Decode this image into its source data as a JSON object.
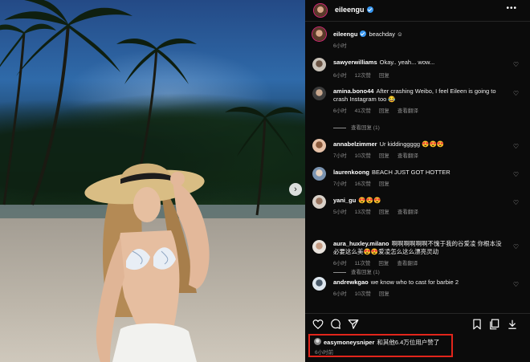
{
  "post": {
    "username": "eileengu",
    "caption": "beachday",
    "caption_emoji": "☺",
    "caption_time": "6小时",
    "menu_icon": "more-icon"
  },
  "comments": [
    {
      "user": "sawyerwilliams",
      "text": "Okay.. yeah... wow...",
      "time": "6小时",
      "likes": "12次赞",
      "reply": "回复",
      "translate": "",
      "view_replies": ""
    },
    {
      "user": "amina.bono44",
      "text": "After crashing Weibo, I feel Eileen is going to crash Instagram too 😂",
      "time": "6小时",
      "likes": "41次赞",
      "reply": "回复",
      "translate": "查看翻译",
      "view_replies": "查看回复 (1)"
    },
    {
      "user": "annabelzimmer",
      "text": "Ur kiddinggggg 😍😍😍",
      "time": "7小时",
      "likes": "10次赞",
      "reply": "回复",
      "translate": "查看翻译",
      "view_replies": ""
    },
    {
      "user": "laurenkoong",
      "text": "BEACH JUST GOT HOTTER",
      "time": "7小时",
      "likes": "16次赞",
      "reply": "回复",
      "translate": "",
      "view_replies": ""
    },
    {
      "user": "yani_gu",
      "text": "😍😍😍",
      "time": "5小时",
      "likes": "13次赞",
      "reply": "回复",
      "translate": "查看翻译",
      "view_replies": ""
    },
    {
      "user": "aura_huxley.milano",
      "text": "啊啊啊啊啊啊不愧于我的谷爱凌 你根本没必要这么美😍😍爱凌怎么这么漂亮灵动",
      "time": "6小时",
      "likes": "11次赞",
      "reply": "回复",
      "translate": "查看翻译",
      "view_replies": "查看回复 (1)"
    },
    {
      "user": "andrewkgao",
      "text": "we know who to cast for barbie 2",
      "time": "6小时",
      "likes": "10次赞",
      "reply": "回复",
      "translate": "",
      "view_replies": ""
    }
  ],
  "likes_summary": {
    "user": "easymoneysniper",
    "text": "和其他6.4万位用户赞了",
    "time": "6小时前"
  },
  "icons": [
    "heart-icon",
    "comment-icon",
    "share-icon",
    "bookmark-icon",
    "save-icon",
    "download-icon",
    "verified-icon",
    "next-arrow-icon"
  ],
  "colors": {
    "panel_bg": "#0b0b0b",
    "verified": "#3897f0",
    "highlight_box": "#e1251b"
  }
}
